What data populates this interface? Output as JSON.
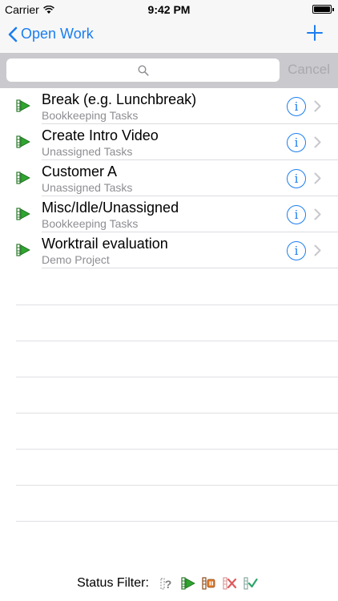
{
  "status_bar": {
    "carrier": "Carrier",
    "time": "9:42 PM"
  },
  "nav": {
    "back_label": "Open Work",
    "add_icon": "plus-icon"
  },
  "search": {
    "placeholder": "",
    "value": "",
    "cancel_label": "Cancel"
  },
  "tasks": [
    {
      "title": "Break (e.g. Lunchbreak)",
      "subtitle": "Bookkeeping Tasks"
    },
    {
      "title": "Create Intro Video",
      "subtitle": "Unassigned Tasks"
    },
    {
      "title": "Customer A",
      "subtitle": "Unassigned Tasks"
    },
    {
      "title": "Misc/Idle/Unassigned",
      "subtitle": "Bookkeeping Tasks"
    },
    {
      "title": "Worktrail evaluation",
      "subtitle": "Demo Project"
    }
  ],
  "footer": {
    "label": "Status Filter:",
    "filters": [
      "unknown-status-icon",
      "running-status-icon",
      "paused-status-icon",
      "cancelled-status-icon",
      "done-status-icon"
    ]
  },
  "colors": {
    "accent": "#1a7ef0",
    "bar_bg": "#f7f7f7",
    "search_bg": "#c9c9ce",
    "secondary_text": "#8e8e93"
  }
}
